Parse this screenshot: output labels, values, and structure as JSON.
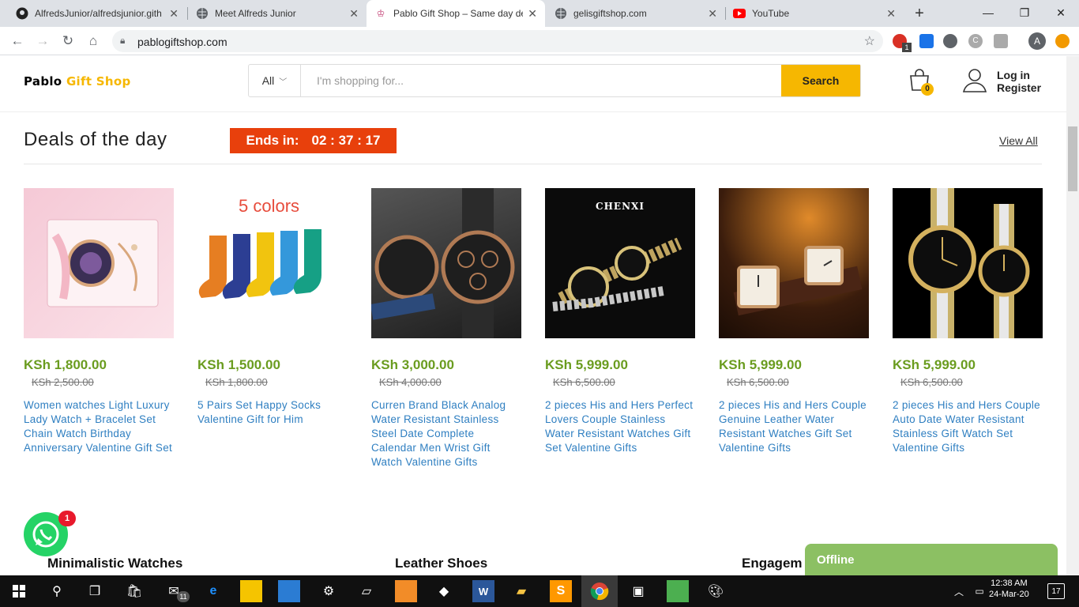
{
  "browser": {
    "tabs": [
      {
        "label": "AlfredsJunior/alfredsjunior.gith",
        "icon": "github-icon"
      },
      {
        "label": "Meet Alfreds Junior",
        "icon": "globe-icon"
      },
      {
        "label": "Pablo Gift Shop – Same day de",
        "icon": "gift-icon"
      },
      {
        "label": "gelisgiftshop.com",
        "icon": "globe-icon"
      },
      {
        "label": "YouTube",
        "icon": "youtube-icon"
      }
    ],
    "url": "pablogiftshop.com",
    "extension_badge": "1",
    "profile_initial": "A"
  },
  "header": {
    "logo_main": "Pablo",
    "logo_accent": "Gift Shop",
    "category_select": "All",
    "search_placeholder": "I'm shopping for...",
    "search_button": "Search",
    "cart_count": "0",
    "login": "Log in",
    "register": "Register",
    "brand_color": "#f6b701"
  },
  "deals": {
    "title": "Deals of the day",
    "countdown_label": "Ends in:",
    "countdown_value": "02 : 37 : 17",
    "view_all": "View All",
    "products": [
      {
        "price": "KSh 1,800.00",
        "old_price": "KSh 2,500.00",
        "name": "Women watches Light Luxury Lady Watch + Bracelet Set Chain Watch Birthday Anniversary Valentine Gift Set"
      },
      {
        "price": "KSh 1,500.00",
        "old_price": "KSh 1,800.00",
        "name": "5 Pairs Set Happy Socks Valentine Gift for Him",
        "image_text": "5 colors"
      },
      {
        "price": "KSh 3,000.00",
        "old_price": "KSh 4,000.00",
        "name": "Curren Brand Black Analog Water Resistant Stainless Steel Date Complete Calendar Men Wrist Gift Watch Valentine Gifts"
      },
      {
        "price": "KSh 5,999.00",
        "old_price": "KSh 6,500.00",
        "name": "2 pieces His and Hers Perfect Lovers Couple Stainless Water Resistant Watches Gift Set Valentine Gifts",
        "image_text": "CHENXI"
      },
      {
        "price": "KSh 5,999.00",
        "old_price": "KSh 6,500.00",
        "name": "2 pieces His and Hers Couple Genuine Leather Water Resistant Watches Gift Set Valentine Gifts"
      },
      {
        "price": "KSh 5,999.00",
        "old_price": "KSh 6,500.00",
        "name": "2 pieces His and Hers Couple Auto Date Water Resistant Stainless Gift Watch Set Valentine Gifts"
      }
    ]
  },
  "categories": [
    "Minimalistic Watches",
    "Leather Shoes",
    "Engagem"
  ],
  "whatsapp_badge": "1",
  "chat_status": "Offline",
  "taskbar": {
    "time": "12:38 AM",
    "date": "24-Mar-20",
    "notification_count": "17",
    "mail_badge": "11"
  }
}
